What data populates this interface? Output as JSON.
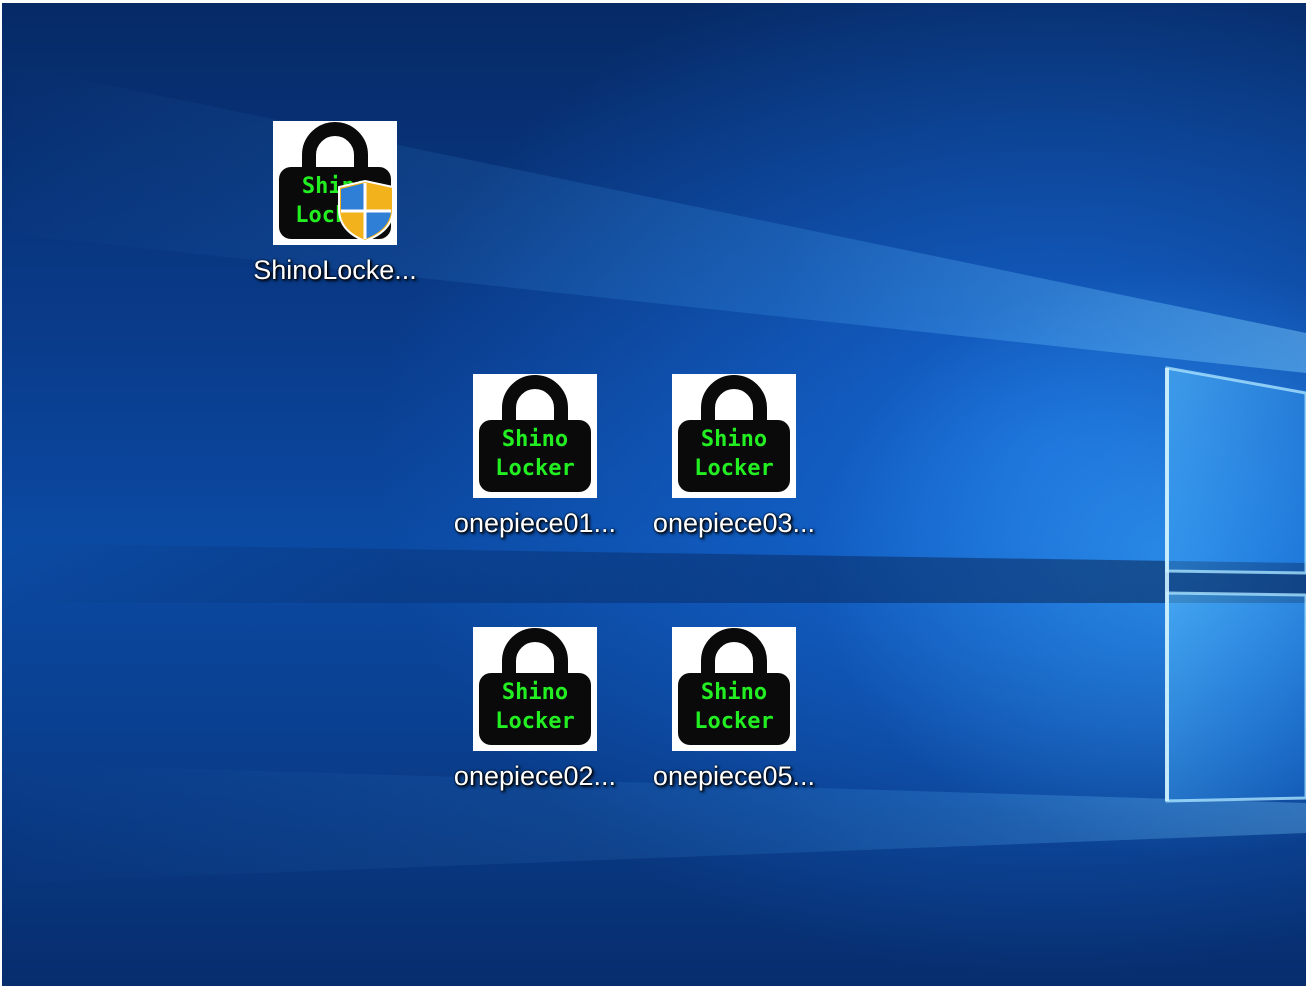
{
  "desktop": {
    "icons": [
      {
        "label": "ShinoLocke...",
        "icon": "shinolocker-padlock-uac-shield-icon",
        "brand_line1": "Shino",
        "brand_line2": "Locker"
      },
      {
        "label": "onepiece01...",
        "icon": "shinolocker-padlock-icon",
        "brand_line1": "Shino",
        "brand_line2": "Locker"
      },
      {
        "label": "onepiece03...",
        "icon": "shinolocker-padlock-icon",
        "brand_line1": "Shino",
        "brand_line2": "Locker"
      },
      {
        "label": "onepiece02...",
        "icon": "shinolocker-padlock-icon",
        "brand_line1": "Shino",
        "brand_line2": "Locker"
      },
      {
        "label": "onepiece05...",
        "icon": "shinolocker-padlock-icon",
        "brand_line1": "Shino",
        "brand_line2": "Locker"
      }
    ]
  },
  "colors": {
    "lock_body": "#0a0a0a",
    "lock_text": "#22ee22",
    "shield_gold": "#f2b21c",
    "shield_blue": "#2f7fd6",
    "label_text": "#ffffff"
  }
}
